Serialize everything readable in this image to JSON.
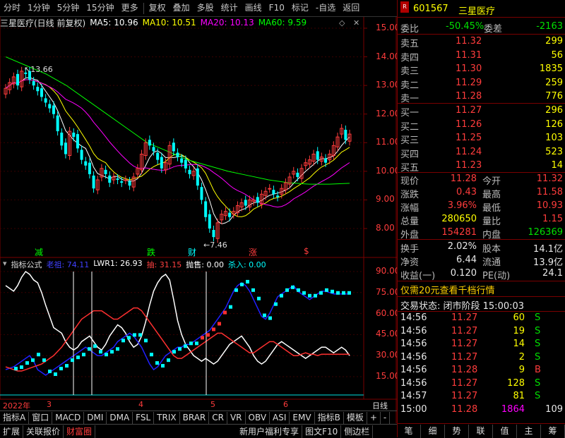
{
  "toolbar": {
    "items": [
      "分时",
      "1分钟",
      "5分钟",
      "15分钟",
      "更多",
      "复权",
      "叠加",
      "多股",
      "统计",
      "画线",
      "F10",
      "标记",
      "-自选",
      "返回"
    ]
  },
  "chart_header": {
    "stock_title": "三星医疗(日线 前复权)",
    "ma5": "MA5: 10.96",
    "ma10": "MA10: 10.51",
    "ma20": "MA20: 10.13",
    "ma60": "MA60: 9.59"
  },
  "price_axis": [
    "15.00",
    "14.00",
    "13.00",
    "12.00",
    "11.00",
    "10.00",
    "9.00",
    "8.00"
  ],
  "annotations": {
    "high": "13.66",
    "low": "7.46"
  },
  "event_markers": [
    "减",
    "跌",
    "财",
    "涨",
    "$"
  ],
  "indicator_header": {
    "name": "指标公式",
    "sub1": "老祖: 74.11",
    "sub2": "LWR1: 26.93",
    "sub3": "抽: 31.15",
    "sub4": "抛售: 0.00",
    "sub5": "杀入: 0.00"
  },
  "ind_axis": [
    "90.00",
    "75.00",
    "60.00",
    "45.00",
    "30.00",
    "15.00"
  ],
  "date_axis": {
    "year": "2022年",
    "m3": "3",
    "m4": "4",
    "m5": "5",
    "m6": "6",
    "period": "日线"
  },
  "tabs_row1": [
    "指标A",
    "窗口",
    "MACD",
    "DMI",
    "DMA",
    "FSL",
    "TRIX",
    "BRAR",
    "CR",
    "VR",
    "OBV",
    "ASI",
    "EMV",
    "指标B",
    "模板",
    "+",
    "-"
  ],
  "tabs_row2": [
    "扩展",
    "关联报价",
    "财富圈",
    "新用户福利专享",
    "图文F10",
    "侧边栏"
  ],
  "quote": {
    "code": "601567",
    "name": "三星医疗",
    "weibi_label": "委比",
    "weibi": "-50.45%",
    "weicha_label": "委差",
    "weicha": "-2163",
    "asks": [
      {
        "label": "卖五",
        "price": "11.32",
        "vol": "299"
      },
      {
        "label": "卖四",
        "price": "11.31",
        "vol": "56"
      },
      {
        "label": "卖三",
        "price": "11.30",
        "vol": "1835"
      },
      {
        "label": "卖二",
        "price": "11.29",
        "vol": "259"
      },
      {
        "label": "卖一",
        "price": "11.28",
        "vol": "776"
      }
    ],
    "bids": [
      {
        "label": "买一",
        "price": "11.27",
        "vol": "296"
      },
      {
        "label": "买二",
        "price": "11.26",
        "vol": "126"
      },
      {
        "label": "买三",
        "price": "11.25",
        "vol": "103"
      },
      {
        "label": "买四",
        "price": "11.24",
        "vol": "523"
      },
      {
        "label": "买五",
        "price": "11.23",
        "vol": "14"
      }
    ],
    "stats": [
      {
        "l1": "现价",
        "v1": "11.28",
        "c1": "red",
        "l2": "今开",
        "v2": "11.32",
        "c2": "red"
      },
      {
        "l1": "涨跌",
        "v1": "0.43",
        "c1": "red",
        "l2": "最高",
        "v2": "11.58",
        "c2": "red"
      },
      {
        "l1": "涨幅",
        "v1": "3.96%",
        "c1": "red",
        "l2": "最低",
        "v2": "10.93",
        "c2": "red"
      },
      {
        "l1": "总量",
        "v1": "280650",
        "c1": "yellow",
        "l2": "量比",
        "v2": "1.15",
        "c2": "red"
      },
      {
        "l1": "外盘",
        "v1": "154281",
        "c1": "red",
        "l2": "内盘",
        "v2": "126369",
        "c2": "green"
      }
    ],
    "stats2": [
      {
        "l1": "换手",
        "v1": "2.02%",
        "l2": "股本",
        "v2": "14.1亿"
      },
      {
        "l1": "净资",
        "v1": "6.44",
        "l2": "流通",
        "v2": "13.9亿"
      },
      {
        "l1": "收益(一)",
        "v1": "0.120",
        "l2": "PE(动)",
        "v2": "24.1"
      }
    ],
    "promo": "仅需20元查看千档行情",
    "trade_state": "交易状态: 闭市阶段 15:00:03",
    "ticks": [
      {
        "t": "14:56",
        "p": "11.27",
        "v": "60",
        "s": "S"
      },
      {
        "t": "14:56",
        "p": "11.27",
        "v": "19",
        "s": "S"
      },
      {
        "t": "14:56",
        "p": "11.27",
        "v": "14",
        "s": "S"
      },
      {
        "t": "14:56",
        "p": "11.27",
        "v": "2",
        "s": "S"
      },
      {
        "t": "14:56",
        "p": "11.28",
        "v": "9",
        "s": "B"
      },
      {
        "t": "14:56",
        "p": "11.27",
        "v": "128",
        "s": "S"
      },
      {
        "t": "14:57",
        "p": "11.27",
        "v": "81",
        "s": "S"
      },
      {
        "t": "15:00",
        "p": "11.28",
        "v": "1864",
        "s": "",
        "n": "109"
      }
    ],
    "bottom_tabs": [
      "笔",
      "细",
      "势",
      "联",
      "值",
      "主",
      "筹"
    ]
  },
  "colors": {
    "up": "#ff3c3c",
    "down": "#00ffff",
    "ma5": "#ffffff",
    "ma10": "#ffff00",
    "ma20": "#ff00ff",
    "ma60": "#00ff00"
  }
}
